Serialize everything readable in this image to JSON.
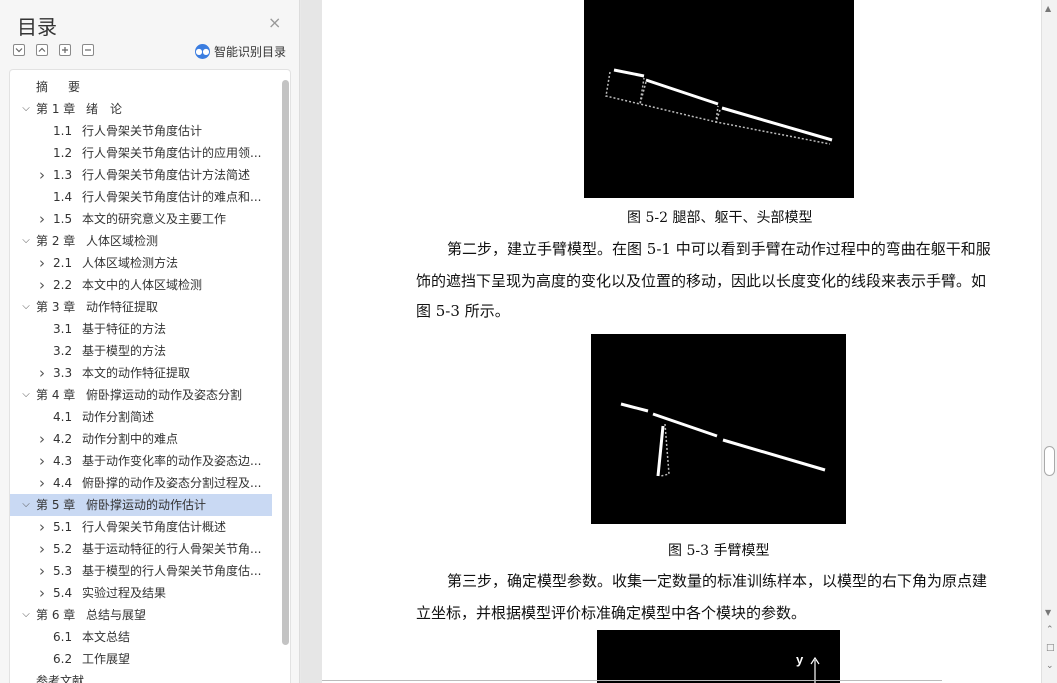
{
  "sidebar": {
    "title": "目录",
    "close_icon": "×",
    "tool_icons": [
      "collapse-all-icon",
      "expand-up-icon",
      "plus-icon",
      "minus-icon"
    ],
    "smart_toc_label": "智能识别目录",
    "items": [
      {
        "level": 0,
        "chevron": "",
        "num": "摘",
        "title": "要"
      },
      {
        "level": 0,
        "chevron": "open",
        "num": "第 1 章",
        "title": "绪　论"
      },
      {
        "level": 1,
        "chevron": "",
        "num": "1.1",
        "title": "行人骨架关节角度估计"
      },
      {
        "level": 1,
        "chevron": "",
        "num": "1.2",
        "title": "行人骨架关节角度估计的应用领..."
      },
      {
        "level": 1,
        "chevron": "closed",
        "num": "1.3",
        "title": "行人骨架关节角度估计方法简述"
      },
      {
        "level": 1,
        "chevron": "",
        "num": "1.4",
        "title": "行人骨架关节角度估计的难点和..."
      },
      {
        "level": 1,
        "chevron": "closed",
        "num": "1.5",
        "title": "本文的研究意义及主要工作"
      },
      {
        "level": 0,
        "chevron": "open",
        "num": "第 2 章",
        "title": "人体区域检测"
      },
      {
        "level": 1,
        "chevron": "closed",
        "num": "2.1",
        "title": "人体区域检测方法"
      },
      {
        "level": 1,
        "chevron": "closed",
        "num": "2.2",
        "title": "本文中的人体区域检测"
      },
      {
        "level": 0,
        "chevron": "open",
        "num": "第 3 章",
        "title": "动作特征提取"
      },
      {
        "level": 1,
        "chevron": "",
        "num": "3.1",
        "title": "基于特征的方法"
      },
      {
        "level": 1,
        "chevron": "",
        "num": "3.2",
        "title": "基于模型的方法"
      },
      {
        "level": 1,
        "chevron": "closed",
        "num": "3.3",
        "title": "本文的动作特征提取"
      },
      {
        "level": 0,
        "chevron": "open",
        "num": "第 4 章",
        "title": "俯卧撑运动的动作及姿态分割"
      },
      {
        "level": 1,
        "chevron": "",
        "num": "4.1",
        "title": "动作分割简述"
      },
      {
        "level": 1,
        "chevron": "closed",
        "num": "4.2",
        "title": "动作分割中的难点"
      },
      {
        "level": 1,
        "chevron": "closed",
        "num": "4.3",
        "title": "基于动作变化率的动作及姿态边..."
      },
      {
        "level": 1,
        "chevron": "closed",
        "num": "4.4",
        "title": "俯卧撑的动作及姿态分割过程及..."
      },
      {
        "level": 0,
        "chevron": "open",
        "num": "第 5 章",
        "title": "俯卧撑运动的动作估计",
        "selected": true
      },
      {
        "level": 1,
        "chevron": "closed",
        "num": "5.1",
        "title": "行人骨架关节角度估计概述"
      },
      {
        "level": 1,
        "chevron": "closed",
        "num": "5.2",
        "title": "基于运动特征的行人骨架关节角..."
      },
      {
        "level": 1,
        "chevron": "closed",
        "num": "5.3",
        "title": "基于模型的行人骨架关节角度估..."
      },
      {
        "level": 1,
        "chevron": "closed",
        "num": "5.4",
        "title": "实验过程及结果"
      },
      {
        "level": 0,
        "chevron": "open",
        "num": "第 6 章",
        "title": "总结与展望"
      },
      {
        "level": 1,
        "chevron": "",
        "num": "6.1",
        "title": "本文总结"
      },
      {
        "level": 1,
        "chevron": "",
        "num": "6.2",
        "title": "工作展望"
      },
      {
        "level": 0,
        "chevron": "",
        "num": "参考文献",
        "title": ""
      }
    ]
  },
  "document": {
    "fig2_caption": "图 5-2 腿部、躯干、头部模型",
    "para1_lines": [
      "第二步，建立手臂模型。在图 5-1 中可以看到手臂在动作过程中的弯曲在躯干和服",
      "饰的遮挡下呈现为高度的变化以及位置的移动，因此以长度变化的线段来表示手臂。如",
      "图 5-3 所示。"
    ],
    "fig3_caption": "图 5-3  手臂模型",
    "para2_lines": [
      "第三步，确定模型参数。收集一定数量的标准训练样本，以模型的右下角为原点建",
      "立坐标，并根据模型评价标准确定模型中各个模块的参数。"
    ],
    "fig4_axis_label": "y"
  },
  "colors": {
    "selected_row": "#c9d9f3",
    "smart_icon": "#3b7de0",
    "figure_background": "#000000"
  }
}
